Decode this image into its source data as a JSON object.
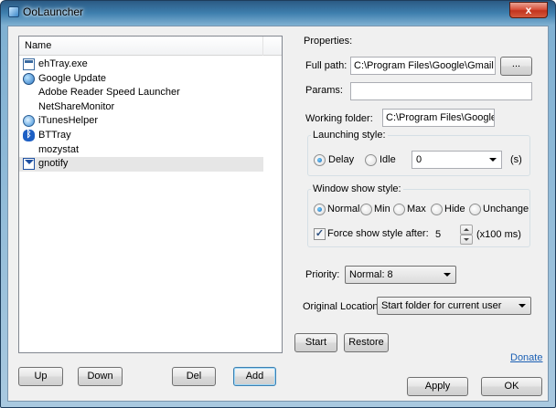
{
  "window": {
    "title": "OoLauncher",
    "close_label": "x"
  },
  "list": {
    "column_header": "Name",
    "items": [
      {
        "label": "ehTray.exe",
        "icon": "exe-icon"
      },
      {
        "label": "Google Update",
        "icon": "globe-icon"
      },
      {
        "label": "Adobe Reader Speed Launcher",
        "icon": ""
      },
      {
        "label": "NetShareMonitor",
        "icon": ""
      },
      {
        "label": "iTunesHelper",
        "icon": "itunes-icon"
      },
      {
        "label": "BTTray",
        "icon": "bluetooth-icon"
      },
      {
        "label": "mozystat",
        "icon": ""
      },
      {
        "label": "gnotify",
        "icon": "mail-icon",
        "selected": true
      }
    ]
  },
  "list_buttons": {
    "up": "Up",
    "down": "Down",
    "del": "Del",
    "add": "Add"
  },
  "properties": {
    "heading": "Properties:",
    "full_path_label": "Full path:",
    "full_path_value": "C:\\Program Files\\Google\\Gmail No",
    "browse_label": "...",
    "params_label": "Params:",
    "params_value": "",
    "working_folder_label": "Working folder:",
    "working_folder_value": "C:\\Program Files\\Google\\G"
  },
  "launching_style": {
    "label": "Launching style:",
    "delay_label": "Delay",
    "idle_label": "Idle",
    "delay_value": "0",
    "unit": "(s)",
    "selected": "Delay"
  },
  "window_show_style": {
    "label": "Window show style:",
    "options": [
      "Normal",
      "Min",
      "Max",
      "Hide",
      "Unchange"
    ],
    "selected": "Normal",
    "force_label": "Force show style after:",
    "force_checked": true,
    "force_value": "5",
    "force_unit": "(x100 ms)"
  },
  "priority": {
    "label": "Priority:",
    "value": "Normal: 8"
  },
  "original_location": {
    "label": "Original Location:",
    "value": "Start folder for current user"
  },
  "actions": {
    "start": "Start",
    "restore": "Restore",
    "donate": "Donate",
    "apply": "Apply",
    "ok": "OK"
  }
}
